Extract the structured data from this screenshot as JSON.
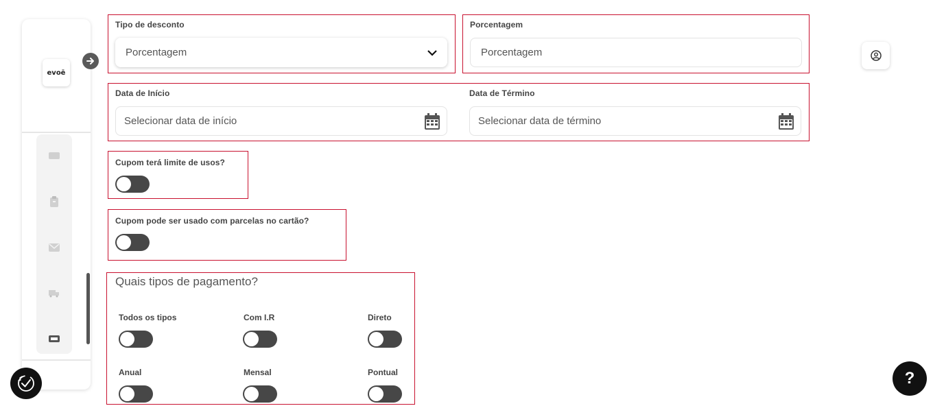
{
  "sidebar": {
    "logo_text": "evoē",
    "nav_icons": [
      "ticket-icon",
      "clipboard-icon",
      "mail-icon",
      "truck-icon",
      "coupon-icon"
    ]
  },
  "discount_type": {
    "label": "Tipo de desconto",
    "selected": "Porcentagem"
  },
  "percentage": {
    "label": "Porcentagem",
    "placeholder": "Porcentagem"
  },
  "start_date": {
    "label": "Data de Início",
    "placeholder": "Selecionar data de início"
  },
  "end_date": {
    "label": "Data de Término",
    "placeholder": "Selecionar data de término"
  },
  "usage_limit": {
    "label": "Cupom terá limite de usos?",
    "enabled": false
  },
  "installments": {
    "label": "Cupom pode ser usado com parcelas no cartão?",
    "enabled": false
  },
  "payment_types": {
    "title": "Quais tipos de pagamento?",
    "options": [
      {
        "label": "Todos os tipos",
        "enabled": false
      },
      {
        "label": "Com I.R",
        "enabled": false
      },
      {
        "label": "Direto",
        "enabled": false
      },
      {
        "label": "Anual",
        "enabled": false
      },
      {
        "label": "Mensal",
        "enabled": false
      },
      {
        "label": "Pontual",
        "enabled": false
      }
    ]
  },
  "help": {
    "label": "?"
  }
}
